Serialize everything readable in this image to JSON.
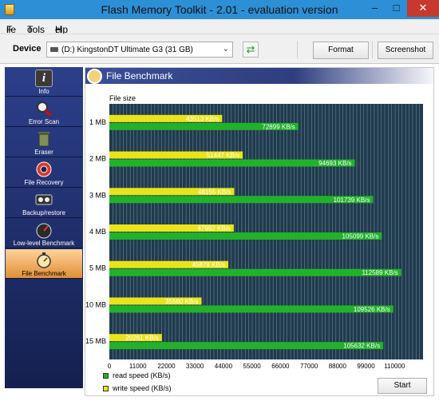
{
  "window": {
    "title": "Flash Memory Toolkit - 2.01 - evaluation version",
    "min_glyph": "–",
    "max_glyph": "□",
    "close_glyph": "✕"
  },
  "menu": [
    {
      "u": "F",
      "rest": "ile"
    },
    {
      "u": "T",
      "rest": "ools"
    },
    {
      "u": "H",
      "rest": "elp"
    }
  ],
  "device": {
    "label": "Device",
    "selected": "(D:) KingstonDT Ultimate G3 (31 GB)",
    "refresh_glyph": "⇄"
  },
  "toolbar": {
    "format": "Format",
    "screenshot": "Screenshot"
  },
  "sidebar": [
    {
      "label": "Info",
      "icon": "info-icon",
      "active": false
    },
    {
      "label": "Error Scan",
      "icon": "magnifier-icon",
      "active": false
    },
    {
      "label": "Eraser",
      "icon": "trash-icon",
      "active": false
    },
    {
      "label": "File Recovery",
      "icon": "lifebuoy-icon",
      "active": false
    },
    {
      "label": "Backup/restore",
      "icon": "tape-icon",
      "active": false
    },
    {
      "label": "Low-level Benchmark",
      "icon": "speedometer-icon",
      "active": false
    },
    {
      "label": "File Benchmark",
      "icon": "stopwatch-icon",
      "active": true
    }
  ],
  "panel_title": "File Benchmark",
  "legend": {
    "read": "read speed (KB/s)",
    "write": "write speed (KB/s)"
  },
  "start_label": "Start",
  "colors": {
    "read": "#22b229",
    "write": "#e9e41a",
    "plot_bg": "#1f3b4d",
    "grid": "#6f8596"
  },
  "chart_data": {
    "type": "bar",
    "orientation": "horizontal",
    "ylabel": "File size",
    "categories": [
      "1 MB",
      "2 MB",
      "3 MB",
      "4 MB",
      "5 MB",
      "10 MB",
      "15 MB"
    ],
    "series": [
      {
        "name": "write speed (KB/s)",
        "values": [
          43513,
          51447,
          48155,
          47992,
          45878,
          35560,
          20261
        ]
      },
      {
        "name": "read speed (KB/s)",
        "values": [
          72899,
          94693,
          101739,
          105099,
          112589,
          109526,
          105632
        ]
      }
    ],
    "value_labels": {
      "write": [
        "43513 KB/s",
        "51447 KB/s",
        "48155 KB/s",
        "47992 KB/s",
        "45878 KB/s",
        "35560 KB/s",
        "20261 KB/s"
      ],
      "read": [
        "72899 KB/s",
        "94693 KB/s",
        "101739 KB/s",
        "105099 KB/s",
        "112589 KB/s",
        "109526 KB/s",
        "105632 KB/s"
      ]
    },
    "xlim": [
      0,
      121000
    ],
    "xticks": [
      0,
      11000,
      22000,
      33000,
      44000,
      55000,
      66000,
      77000,
      88000,
      99000,
      110000
    ],
    "grid": true,
    "legend_position": "bottom-left"
  }
}
